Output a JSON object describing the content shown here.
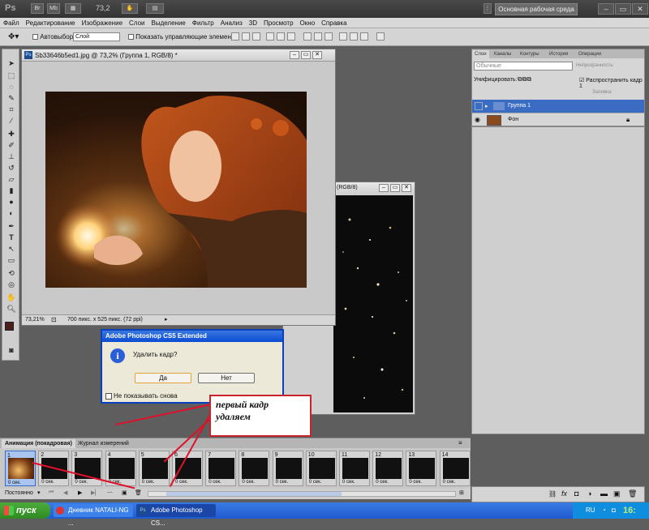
{
  "titlebar": {
    "app_logo": "Ps",
    "zoom": "73,2",
    "workspace_button": "Основная рабочая среда"
  },
  "menu": [
    "Файл",
    "Редактирование",
    "Изображение",
    "Слои",
    "Выделение",
    "Фильтр",
    "Анализ",
    "3D",
    "Просмотр",
    "Окно",
    "Справка"
  ],
  "options": {
    "autoselect_label": "Автовыбор:",
    "autoselect_value": "Слой",
    "show_controls_label": "Показать управляющие элементы"
  },
  "doc1": {
    "title": "Sb33646b5ed1.jpg @ 73,2% (Группа 1, RGB/8) *",
    "zoom": "73,21%",
    "info": "700 пикс. x 525 пикс. (72 ppi)"
  },
  "doc2": {
    "title_fragment": "(RGB/8)"
  },
  "layers_panel": {
    "tabs": [
      "Слои",
      "Каналы",
      "Контуры",
      "История",
      "Операции"
    ],
    "blend_mode": "Обычные",
    "opacity_label": "Непрозрачность:",
    "unify_label": "Унифицировать:",
    "propagate_label": "Распространить кадр 1",
    "lock_label": "Закрепить:",
    "fill_label": "Заливка:",
    "layers": [
      {
        "name": "Группа 1",
        "selected": true
      },
      {
        "name": "Фон",
        "selected": false
      }
    ]
  },
  "dialog": {
    "title": "Adobe Photoshop CS5 Extended",
    "message": "Удалить кадр?",
    "yes": "Да",
    "no": "Нет",
    "dont_show": "Не показывать снова"
  },
  "callout": {
    "line1": "первый кадр",
    "line2": "удаляем"
  },
  "animation": {
    "tab_active": "Анимация (покадровая)",
    "tab_other": "Журнал измерений",
    "loop": "Постоянно",
    "frames": [
      {
        "num": "1",
        "delay": "0 сек."
      },
      {
        "num": "2",
        "delay": "0 сек."
      },
      {
        "num": "3",
        "delay": "0 сек."
      },
      {
        "num": "4",
        "delay": "0 сек."
      },
      {
        "num": "5",
        "delay": "0 сек."
      },
      {
        "num": "6",
        "delay": "0 сек."
      },
      {
        "num": "7",
        "delay": "0 сек."
      },
      {
        "num": "8",
        "delay": "0 сек."
      },
      {
        "num": "9",
        "delay": "0 сек."
      },
      {
        "num": "10",
        "delay": "0 сек."
      },
      {
        "num": "11",
        "delay": "0 сек."
      },
      {
        "num": "12",
        "delay": "0 сек."
      },
      {
        "num": "13",
        "delay": "0 сек."
      },
      {
        "num": "14",
        "delay": "0 сек."
      }
    ]
  },
  "taskbar": {
    "start": "пуск",
    "tasks": [
      "Дневник NATALI-NG ...",
      "Adobe Photoshop CS..."
    ],
    "lang": "RU",
    "clock": "16:"
  },
  "colors": {
    "selection_blue": "#3a6cc4",
    "callout_red": "#c9242c",
    "xp_blue": "#1f5bd1"
  }
}
